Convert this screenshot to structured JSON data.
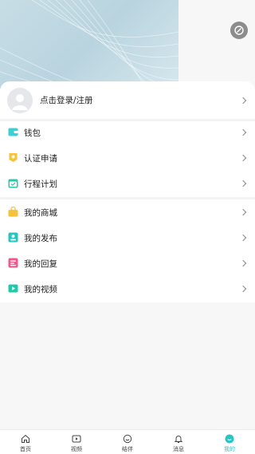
{
  "profile": {
    "login_text": "点击登录/注册"
  },
  "menu_group1": [
    {
      "label": "钱包",
      "icon": "wallet-icon",
      "color": "#3ad0d8"
    },
    {
      "label": "认证申请",
      "icon": "certificate-icon",
      "color": "#f5c23a"
    },
    {
      "label": "行程计划",
      "icon": "calendar-icon",
      "color": "#2cc7b1"
    }
  ],
  "menu_group2": [
    {
      "label": "我的商城",
      "icon": "shopping-bag-icon",
      "color": "#f5c23a"
    },
    {
      "label": "我的发布",
      "icon": "publish-icon",
      "color": "#23c4c2"
    },
    {
      "label": "我的回复",
      "icon": "reply-icon",
      "color": "#ef5a8a"
    },
    {
      "label": "我的视频",
      "icon": "video-icon",
      "color": "#1fcaa9"
    }
  ],
  "tabbar": {
    "items": [
      {
        "label": "首页",
        "icon": "home-icon"
      },
      {
        "label": "视频",
        "icon": "video-play-icon"
      },
      {
        "label": "结伴",
        "icon": "smile-icon"
      },
      {
        "label": "消息",
        "icon": "bell-icon"
      },
      {
        "label": "我的",
        "icon": "profile-icon"
      }
    ],
    "active_index": 4,
    "active_color": "#2bc4c6"
  }
}
